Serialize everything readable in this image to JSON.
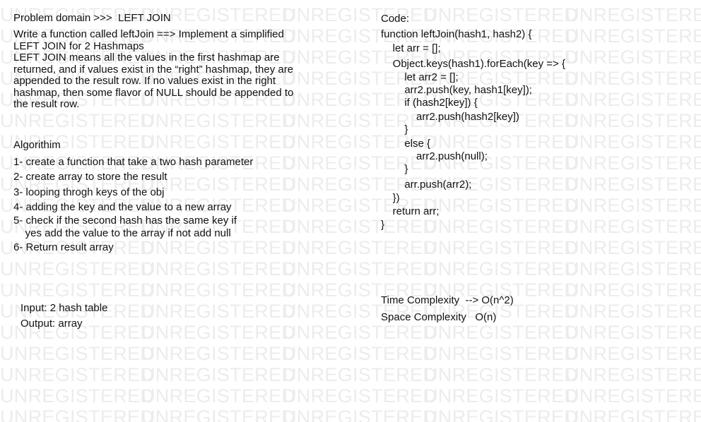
{
  "watermark": {
    "text": "UNREGISTERED"
  },
  "left": {
    "problem_heading": "Problem domain >>>  LEFT JOIN",
    "description": "Write a function called leftJoin ==> Implement a simplified LEFT JOIN for 2 Hashmaps\n LEFT JOIN means all the values in the first hashmap are returned, and if values exist in the “right” hashmap, they are appended to the result row. If no values exist in the right hashmap, then some flavor of NULL should be appended to the result row.",
    "algorithm_heading": "Algorithim",
    "steps": [
      "1- create a function that take a two hash parameter",
      "2- create array to store the result",
      "3- looping throgh keys of the obj",
      "4- adding the key and the value to a new array",
      "5- check if the second hash has the same key if\n    yes add the value to the array if not add null",
      "6- Return result array"
    ],
    "input": "Input: 2 hash table",
    "output": "Output: array"
  },
  "right": {
    "code_heading": "Code:",
    "code_lines": [
      "function leftJoin(hash1, hash2) {",
      "    let arr = [];",
      "    Object.keys(hash1).forEach(key => {",
      "        let arr2 = [];",
      "        arr2.push(key, hash1[key]);",
      "        if (hash2[key]) {",
      "            arr2.push(hash2[key])",
      "        }",
      "        else {",
      "            arr2.push(null);",
      "        }",
      "        arr.push(arr2);",
      "    })",
      "    return arr;",
      "}"
    ],
    "time_complexity": "Time Complexity  --> O(n^2)",
    "space_complexity": "Space Complexity   O(n)"
  }
}
